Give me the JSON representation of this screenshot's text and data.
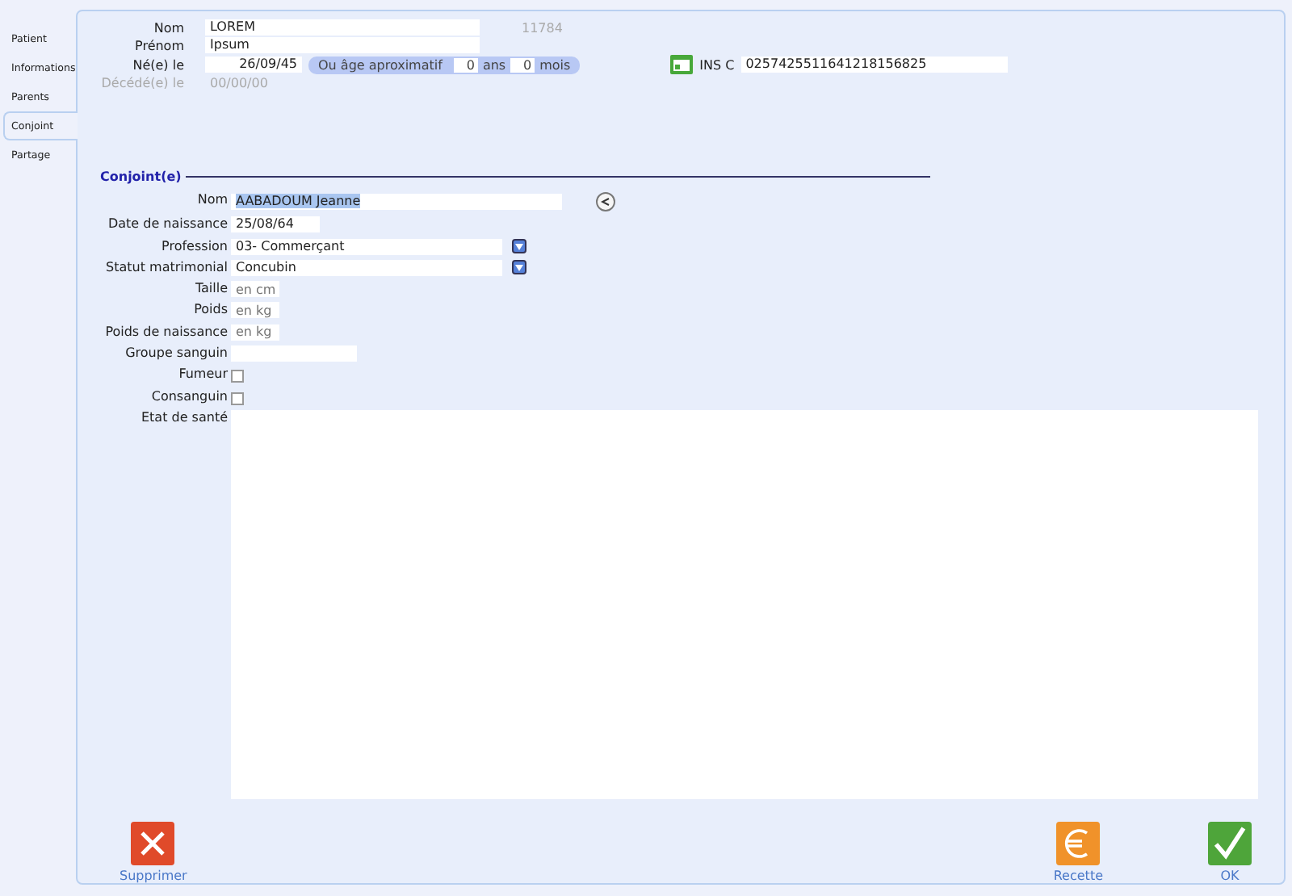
{
  "tabs": [
    {
      "label": "Patient",
      "selected": false
    },
    {
      "label": "Informations",
      "selected": false
    },
    {
      "label": "Parents",
      "selected": false
    },
    {
      "label": "Conjoint",
      "selected": true
    },
    {
      "label": "Partage",
      "selected": false
    }
  ],
  "patient": {
    "nom": {
      "label": "Nom",
      "value": "LOREM"
    },
    "id": "11784",
    "prenom": {
      "label": "Prénom",
      "value": "Ipsum"
    },
    "naissance": {
      "label": "Né(e) le",
      "value": "26/09/45"
    },
    "age": {
      "label": "Ou âge aproximatif",
      "years": "0",
      "years_unit": "ans",
      "months": "0",
      "months_unit": "mois"
    },
    "deces": {
      "label": "Décédé(e) le",
      "value": "00/00/00",
      "disabled": true
    },
    "ins": {
      "label": "INS C",
      "value": "0257425511641218156825"
    }
  },
  "section_title": "Conjoint(e)",
  "spouse_fields": [
    {
      "kind": "name",
      "label": "Nom",
      "value": "AABADOUM Jeanne"
    },
    {
      "kind": "short",
      "label": "Date de naissance",
      "value": "25/08/64"
    },
    {
      "kind": "select",
      "label": "Profession",
      "value": "03- Commerçant"
    },
    {
      "kind": "select",
      "label": "Statut matrimonial",
      "value": "Concubin"
    },
    {
      "kind": "unit",
      "label": "Taille",
      "placeholder": "en cm"
    },
    {
      "kind": "unit",
      "label": "Poids",
      "placeholder": "en kg"
    },
    {
      "kind": "unit",
      "label": "Poids de naissance",
      "placeholder": "en kg"
    },
    {
      "kind": "medium",
      "label": "Groupe sanguin"
    },
    {
      "kind": "checkbox",
      "label": "Fumeur",
      "checked": false
    },
    {
      "kind": "checkbox",
      "label": "Consanguin",
      "checked": false
    },
    {
      "kind": "textarea",
      "label": "Etat de santé"
    }
  ],
  "buttons": [
    {
      "kind": "delete",
      "label": "Supprimer"
    },
    {
      "kind": "spacer"
    },
    {
      "kind": "receipt",
      "label": "Recette"
    },
    {
      "kind": "ok",
      "label": "OK"
    }
  ]
}
